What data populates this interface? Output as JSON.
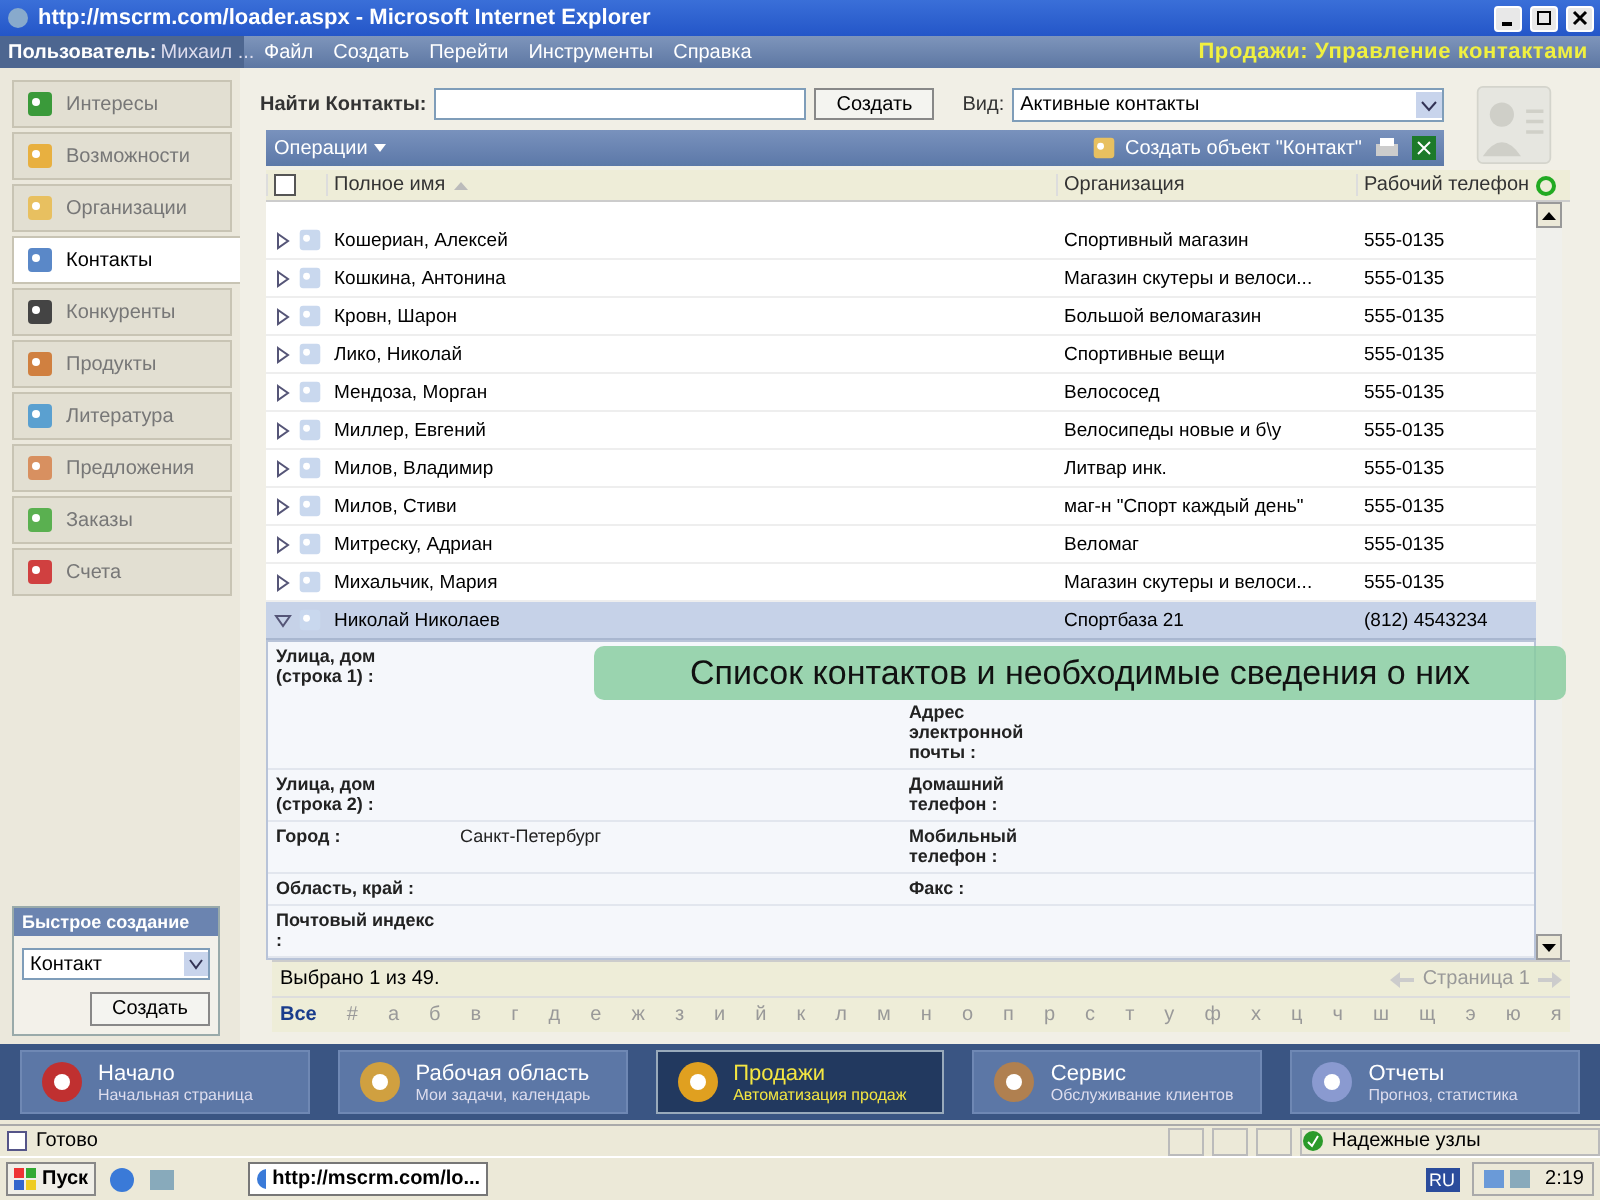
{
  "window": {
    "title": "http://mscrm.com/loader.aspx - Microsoft Internet Explorer"
  },
  "menubar": {
    "user_label": "Пользователь:",
    "user_name": "Михаил ...",
    "items": [
      "Файл",
      "Создать",
      "Перейти",
      "Инструменты",
      "Справка"
    ],
    "area_title": "Продажи: Управление контактами"
  },
  "sidebar": {
    "items": [
      {
        "label": "Интересы",
        "selected": false
      },
      {
        "label": "Возможности",
        "selected": false
      },
      {
        "label": "Организации",
        "selected": false
      },
      {
        "label": "Контакты",
        "selected": true
      },
      {
        "label": "Конкуренты",
        "selected": false
      },
      {
        "label": "Продукты",
        "selected": false
      },
      {
        "label": "Литература",
        "selected": false
      },
      {
        "label": "Предложения",
        "selected": false
      },
      {
        "label": "Заказы",
        "selected": false
      },
      {
        "label": "Счета",
        "selected": false
      }
    ],
    "quick_create": {
      "title": "Быстрое создание",
      "value": "Контакт",
      "button": "Создать"
    }
  },
  "search": {
    "label": "Найти Контакты:",
    "button": "Создать",
    "view_label": "Вид:",
    "view_value": "Активные контакты"
  },
  "toolbar": {
    "operations": "Операции",
    "create": "Создать объект \"Контакт\""
  },
  "table": {
    "select_all_checked": false,
    "columns": [
      "Полное имя",
      "Организация",
      "Рабочий телефон"
    ],
    "rows": [
      {
        "name": "Кошериан, Алексей",
        "organization": "Спортивный магазин",
        "phone": "555-0135",
        "expanded": false
      },
      {
        "name": "Кошкина, Антонина",
        "organization": "Магазин скутеры и велоси...",
        "phone": "555-0135",
        "expanded": false
      },
      {
        "name": "Кровн, Шарон",
        "organization": "Большой веломагазин",
        "phone": "555-0135",
        "expanded": false
      },
      {
        "name": "Лико, Николай",
        "organization": "Спортивные вещи",
        "phone": "555-0135",
        "expanded": false
      },
      {
        "name": "Мендоза, Морган",
        "organization": "Велососед",
        "phone": "555-0135",
        "expanded": false
      },
      {
        "name": "Миллер, Евгений",
        "organization": "Велосипеды новые и б\\у",
        "phone": "555-0135",
        "expanded": false
      },
      {
        "name": "Милов, Владимир",
        "organization": "Литвар инк.",
        "phone": "555-0135",
        "expanded": false
      },
      {
        "name": "Милов, Стиви",
        "organization": "маг-н \"Спорт каждый день\"",
        "phone": "555-0135",
        "expanded": false
      },
      {
        "name": "Митреску, Адриан",
        "organization": "Веломаг",
        "phone": "555-0135",
        "expanded": false
      },
      {
        "name": "Михальчик, Мария",
        "organization": "Магазин скутеры и велоси...",
        "phone": "555-0135",
        "expanded": false
      },
      {
        "name": "Николай Николаев",
        "organization": "Спортбаза 21",
        "phone": "(812) 4543234",
        "expanded": true
      }
    ],
    "details": [
      {
        "left_label": "Улица, дом (строка 1) :",
        "right_label": "Адрес электронной почты :"
      },
      {
        "left_label": "Улица, дом (строка 2) :",
        "right_label": "Домашний телефон :"
      },
      {
        "left_label": "Город :",
        "left_value": "Санкт-Петербург",
        "right_label": "Мобильный телефон :"
      },
      {
        "left_label": "Область, край :",
        "right_label": "Факс :"
      },
      {
        "left_label": "Почтовый индекс :"
      }
    ]
  },
  "footer": {
    "selection": "Выбрано 1 из 49.",
    "page": "Страница 1",
    "letters": [
      {
        "label": "Все",
        "selected": true
      },
      {
        "label": "#",
        "selected": false
      },
      {
        "label": "а",
        "selected": false
      },
      {
        "label": "б",
        "selected": false
      },
      {
        "label": "в",
        "selected": false
      },
      {
        "label": "г",
        "selected": false
      },
      {
        "label": "д",
        "selected": false
      },
      {
        "label": "е",
        "selected": false
      },
      {
        "label": "ж",
        "selected": false
      },
      {
        "label": "з",
        "selected": false
      },
      {
        "label": "и",
        "selected": false
      },
      {
        "label": "й",
        "selected": false
      },
      {
        "label": "к",
        "selected": false
      },
      {
        "label": "л",
        "selected": false
      },
      {
        "label": "м",
        "selected": false
      },
      {
        "label": "н",
        "selected": false
      },
      {
        "label": "о",
        "selected": false
      },
      {
        "label": "п",
        "selected": false
      },
      {
        "label": "р",
        "selected": false
      },
      {
        "label": "с",
        "selected": false
      },
      {
        "label": "т",
        "selected": false
      },
      {
        "label": "у",
        "selected": false
      },
      {
        "label": "ф",
        "selected": false
      },
      {
        "label": "х",
        "selected": false
      },
      {
        "label": "ц",
        "selected": false
      },
      {
        "label": "ч",
        "selected": false
      },
      {
        "label": "ш",
        "selected": false
      },
      {
        "label": "щ",
        "selected": false
      },
      {
        "label": "э",
        "selected": false
      },
      {
        "label": "ю",
        "selected": false
      },
      {
        "label": "я",
        "selected": false
      }
    ]
  },
  "nav": [
    {
      "title": "Начало",
      "subtitle": "Начальная страница",
      "selected": false
    },
    {
      "title": "Рабочая область",
      "subtitle": "Мои задачи, календарь",
      "selected": false
    },
    {
      "title": "Продажи",
      "subtitle": "Автоматизация продаж",
      "selected": true
    },
    {
      "title": "Сервис",
      "subtitle": "Обслуживание клиентов",
      "selected": false
    },
    {
      "title": "Отчеты",
      "subtitle": "Прогноз, статистика",
      "selected": false
    }
  ],
  "status_bar": {
    "text": "Готово",
    "zone": "Надежные узлы"
  },
  "taskbar": {
    "start": "Пуск",
    "window": "http://mscrm.com/lo...",
    "language": "RU",
    "time": "2:19"
  },
  "caption": "Список контактов и необходимые сведения о них"
}
